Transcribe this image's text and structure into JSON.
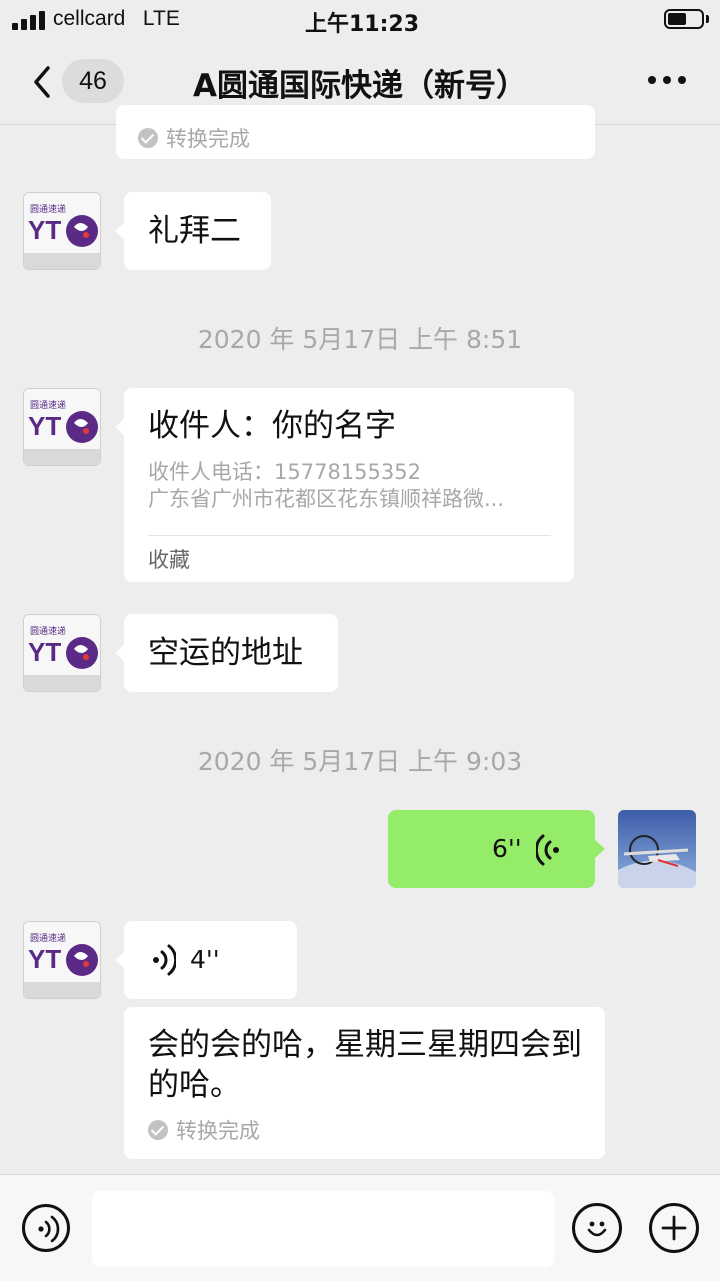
{
  "status_bar": {
    "carrier": "cellcard",
    "network": "LTE",
    "time": "上午11:23"
  },
  "nav": {
    "unread_count": "46",
    "title": "A圆通国际快递（新号）"
  },
  "messages": {
    "top_convert_status": "转换完成",
    "msg1_text": "礼拜二",
    "timestamp1": "2020 年 5月17日 上午 8:51",
    "card": {
      "title": "收件人：你的名字",
      "phone": "收件人电话：15778155352",
      "address": "广东省广州市花都区花东镇顺祥路微...",
      "footer": "收藏"
    },
    "msg3_text": "空运的地址",
    "timestamp2": "2020 年 5月17日 上午 9:03",
    "voice_out_duration": "6''",
    "voice_in_duration": "4''",
    "transcript_text": "会的会的哈，星期三星期四会到的哈。",
    "transcript_status": "转换完成"
  },
  "avatar_logo": {
    "line1": "圆通速递",
    "brand": "YT",
    "accent_color": "#5b2a86"
  },
  "colors": {
    "background": "#ededed",
    "bubble_outgoing": "#95ec69",
    "bubble_incoming": "#ffffff"
  }
}
